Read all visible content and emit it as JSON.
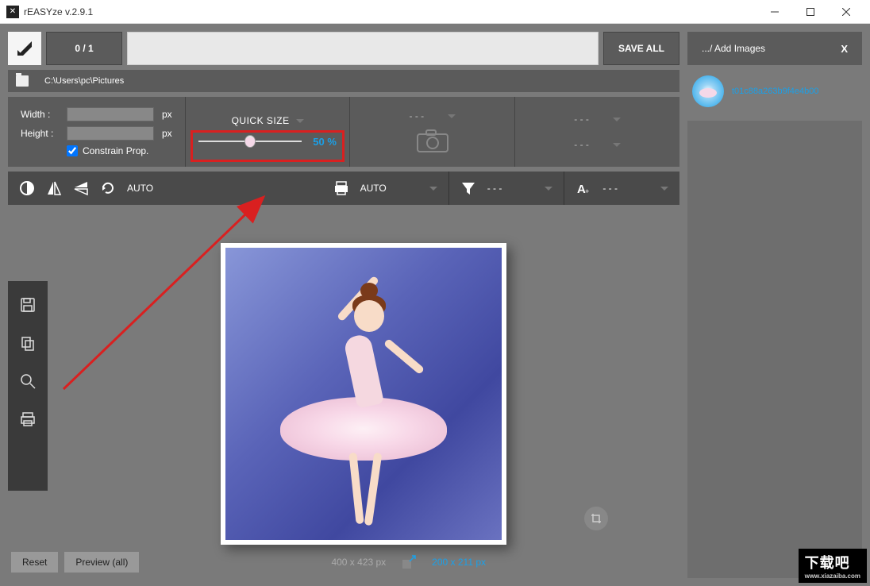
{
  "window": {
    "title": "rEASYze v.2.9.1"
  },
  "top": {
    "counter": "0 / 1",
    "save_all": "SAVE ALL"
  },
  "path": {
    "value": "C:\\Users\\pc\\Pictures"
  },
  "dims": {
    "width_label": "Width :",
    "width_value": "",
    "width_unit": "px",
    "height_label": "Height :",
    "height_value": "",
    "height_unit": "px",
    "constrain_label": "Constrain Prop.",
    "constrain_checked": true
  },
  "quicksize": {
    "label": "QUICK SIZE",
    "value": "50 %",
    "percent": 50
  },
  "camera": {
    "dash": "- - -"
  },
  "extra": {
    "dash": "- - -"
  },
  "tools": {
    "rotate_label": "AUTO",
    "print_label": "AUTO",
    "filter_label": "- - -",
    "text_label": "- - -"
  },
  "bottom": {
    "reset": "Reset",
    "preview_all": "Preview (all)",
    "orig_dim": "400 x 423 px",
    "new_dim": "200 x 211 px"
  },
  "right": {
    "add_images": ".../ Add Images",
    "close": "X",
    "thumb_name": "t01c88a263b9f4e4b00"
  },
  "watermark": {
    "text": "下载吧",
    "url": "www.xiazaiba.com"
  }
}
